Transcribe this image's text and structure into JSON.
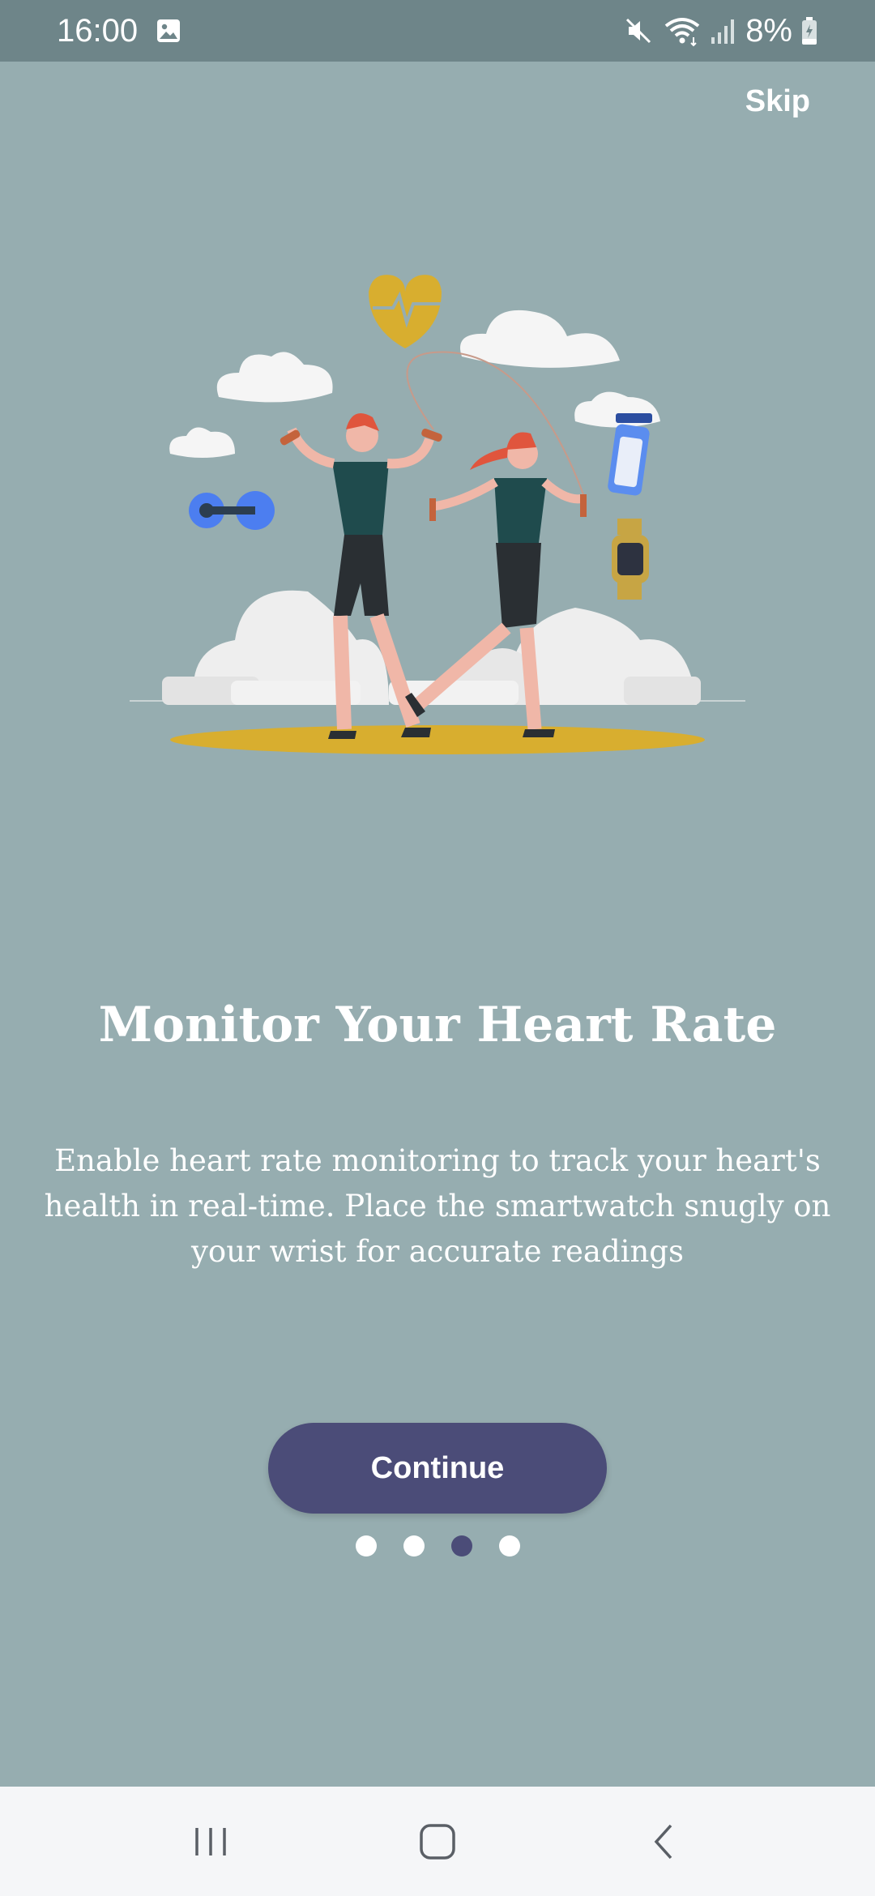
{
  "status_bar": {
    "time": "16:00",
    "battery": "8%",
    "icons": [
      "image-icon",
      "mute-icon",
      "wifi-icon",
      "signal-icon",
      "battery-icon"
    ]
  },
  "header": {
    "skip_label": "Skip"
  },
  "illustration": {
    "icon": "fitness-couple-illustration"
  },
  "content": {
    "title": "Monitor Your Heart Rate",
    "description": "Enable heart rate monitoring to track your heart's health in real-time. Place the smartwatch snugly on your wrist for accurate readings"
  },
  "actions": {
    "continue_label": "Continue"
  },
  "pagination": {
    "total": 4,
    "active_index": 2
  },
  "nav_bar": {
    "icons": [
      "recent-apps-icon",
      "home-icon",
      "back-icon"
    ]
  },
  "colors": {
    "background": "#96adb0",
    "status_bar": "#6e8589",
    "accent": "#4b4c78",
    "nav_bar": "#f5f6f8"
  }
}
